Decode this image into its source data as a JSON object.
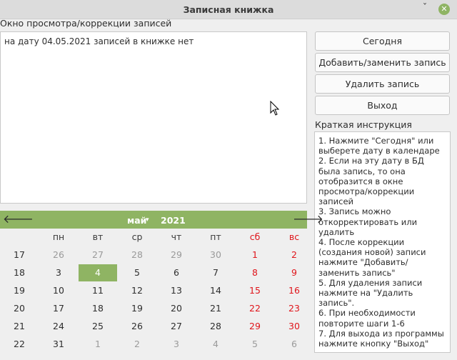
{
  "window": {
    "title": "Записная книжка",
    "minimize_glyph": "ˇ"
  },
  "view": {
    "label": "Окно просмотра/коррекции записей",
    "text": "на дату 04.05.2021 записей в книжке нет"
  },
  "buttons": {
    "today": "Сегодня",
    "add_replace": "Добавить/заменить запись",
    "delete": "Удалить запись",
    "exit": "Выход"
  },
  "instructions": {
    "label": "Краткая инструкция",
    "lines": [
      "1. Нажмите \"Сегодня\" или выберете дату в календаре",
      "2. Если на эту дату в БД была запись, то она отобразится в окне просмотра/коррекции записей",
      "3. Запись можно откорректировать или удалить",
      "4. После коррекции (создания новой) записи нажмите \"Добавить/заменить запись\"",
      "5. Для удаления записи нажмите на \"Удалить запись\".",
      "6. При необходимости повторите шаги 1-6",
      "7. Для выхода из программы нажмите кнопку \"Выход\""
    ]
  },
  "calendar": {
    "month": "май",
    "year": "2021",
    "prev_glyph": "🡐",
    "next_glyph": "🡒",
    "weekdays": [
      "пн",
      "вт",
      "ср",
      "чт",
      "пт",
      "сб",
      "вс"
    ],
    "weeks": [
      {
        "num": "17",
        "days": [
          {
            "d": "26",
            "other": true
          },
          {
            "d": "27",
            "other": true
          },
          {
            "d": "28",
            "other": true
          },
          {
            "d": "29",
            "other": true
          },
          {
            "d": "30",
            "other": true
          },
          {
            "d": "1"
          },
          {
            "d": "2"
          }
        ]
      },
      {
        "num": "18",
        "days": [
          {
            "d": "3"
          },
          {
            "d": "4",
            "selected": true
          },
          {
            "d": "5"
          },
          {
            "d": "6"
          },
          {
            "d": "7"
          },
          {
            "d": "8"
          },
          {
            "d": "9"
          }
        ]
      },
      {
        "num": "19",
        "days": [
          {
            "d": "10"
          },
          {
            "d": "11"
          },
          {
            "d": "12"
          },
          {
            "d": "13"
          },
          {
            "d": "14"
          },
          {
            "d": "15"
          },
          {
            "d": "16"
          }
        ]
      },
      {
        "num": "20",
        "days": [
          {
            "d": "17"
          },
          {
            "d": "18"
          },
          {
            "d": "19"
          },
          {
            "d": "20"
          },
          {
            "d": "21"
          },
          {
            "d": "22"
          },
          {
            "d": "23"
          }
        ]
      },
      {
        "num": "21",
        "days": [
          {
            "d": "24"
          },
          {
            "d": "25"
          },
          {
            "d": "26"
          },
          {
            "d": "27"
          },
          {
            "d": "28"
          },
          {
            "d": "29"
          },
          {
            "d": "30"
          }
        ]
      },
      {
        "num": "22",
        "days": [
          {
            "d": "31"
          },
          {
            "d": "1",
            "other": true
          },
          {
            "d": "2",
            "other": true
          },
          {
            "d": "3",
            "other": true
          },
          {
            "d": "4",
            "other": true
          },
          {
            "d": "5",
            "other": true
          },
          {
            "d": "6",
            "other": true
          }
        ]
      }
    ]
  },
  "colors": {
    "accent": "#8fb463",
    "weekend": "#e0151b",
    "other_month": "#9a9a9a"
  }
}
